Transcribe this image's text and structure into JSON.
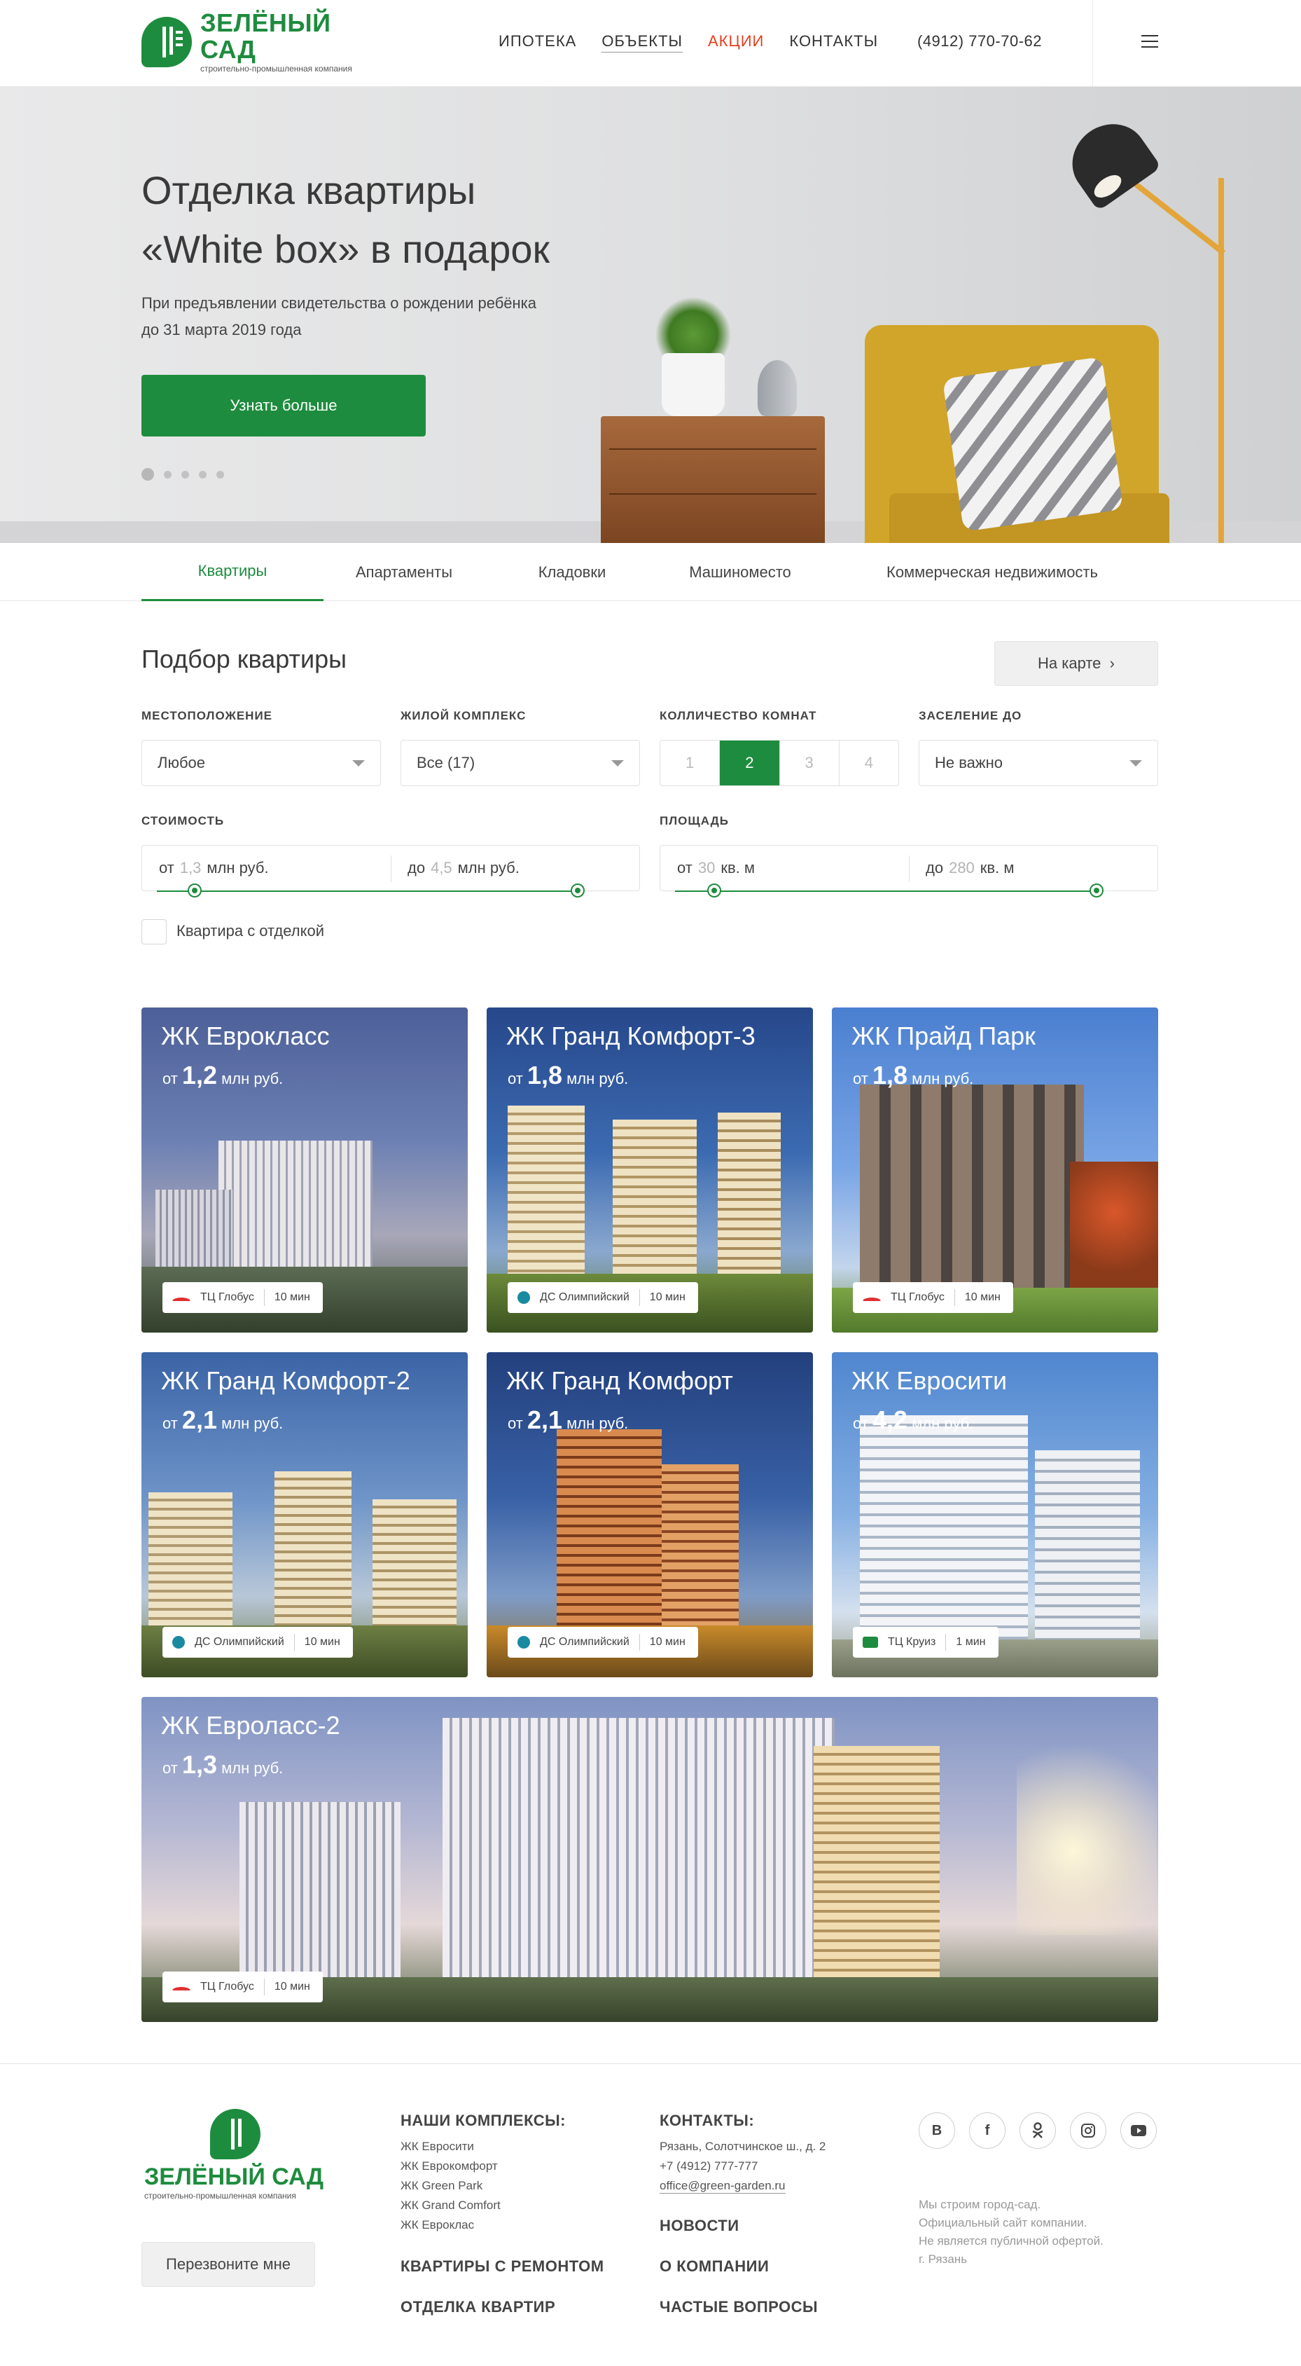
{
  "header": {
    "logo_title": "ЗЕЛЁНЫЙ САД",
    "logo_subtitle": "строительно-промышленная компания",
    "nav": [
      "ИПОТЕКА",
      "ОБЪЕКТЫ",
      "АКЦИИ",
      "КОНТАКТЫ"
    ],
    "phone": "(4912) 770-70-62",
    "menu_icon": "hamburger-icon"
  },
  "hero": {
    "title_line1": "Отделка квартиры",
    "title_line2": "«White box» в подарок",
    "subtitle_line1": "При предъявлении свидетельства о рождении ребёнка",
    "subtitle_line2": "до 31 марта 2019 года",
    "button": "Узнать больше",
    "slides_total": 5,
    "slide_active": 1
  },
  "tabs": [
    "Квартиры",
    "Апартаменты",
    "Кладовки",
    "Машиноместо",
    "Коммерческая недвижимость"
  ],
  "filter": {
    "title": "Подбор квартиры",
    "map_button": "На карте",
    "location_label": "МЕСТОПОЛОЖЕНИЕ",
    "location_value": "Любое",
    "complex_label": "ЖИЛОЙ КОМПЛЕКС",
    "complex_value": "Все (17)",
    "rooms_label": "КОЛЛИЧЕСТВО КОМНАТ",
    "rooms": [
      "1",
      "2",
      "3",
      "4"
    ],
    "rooms_selected": "2",
    "settle_label": "ЗАСЕЛЕНИЕ ДО",
    "settle_value": "Не важно",
    "price_label": "СТОИМОСТЬ",
    "price_from_prefix": "от",
    "price_from": "1,3",
    "price_unit": "млн руб.",
    "price_to_prefix": "до",
    "price_to": "4,5",
    "area_label": "ПЛОЩАДЬ",
    "area_from_prefix": "от",
    "area_from": "30",
    "area_unit": "кв. м",
    "area_to_prefix": "до",
    "area_to": "280",
    "finish_label": "Квартира с отделкой"
  },
  "cards": [
    {
      "title": "ЖК Еврокласс",
      "from": "от",
      "price": "1,2",
      "unit": "млн руб.",
      "place": "ТЦ Глобус",
      "time": "10 мин",
      "icon": "red"
    },
    {
      "title": "ЖК Гранд Комфорт-3",
      "from": "от",
      "price": "1,8",
      "unit": "млн руб.",
      "place": "ДС Олимпийский",
      "time": "10 мин",
      "icon": "teal"
    },
    {
      "title": "ЖК Прайд Парк",
      "from": "от",
      "price": "1,8",
      "unit": "млн руб.",
      "place": "ТЦ Глобус",
      "time": "10 мин",
      "icon": "red"
    },
    {
      "title": "ЖК Гранд Комфорт-2",
      "from": "от",
      "price": "2,1",
      "unit": "млн руб.",
      "place": "ДС Олимпийский",
      "time": "10 мин",
      "icon": "teal"
    },
    {
      "title": "ЖК Гранд Комфорт",
      "from": "от",
      "price": "2,1",
      "unit": "млн руб.",
      "place": "ДС Олимпийский",
      "time": "10 мин",
      "icon": "teal"
    },
    {
      "title": "ЖК Евросити",
      "from": "от",
      "price": "4,2",
      "unit": "млн руб.",
      "place": "ТЦ Круиз",
      "time": "1 мин",
      "icon": "green"
    },
    {
      "title": "ЖК Евроласс-2",
      "from": "от",
      "price": "1,3",
      "unit": "млн руб.",
      "place": "ТЦ Глобус",
      "time": "10 мин",
      "icon": "red"
    }
  ],
  "footer": {
    "logo_title": "ЗЕЛЁНЫЙ САД",
    "logo_subtitle": "строительно-промышленная компания",
    "callback": "Перезвоните мне",
    "complexes_title": "НАШИ КОМПЛЕКСЫ:",
    "complexes": [
      "ЖК Евросити",
      "ЖК Еврокомфорт",
      "ЖК Green Park",
      "ЖК Grand Comfort",
      "ЖК Евроклас"
    ],
    "repair_flats": "КВАРТИРЫ С РЕМОНТОМ",
    "finishing": "ОТДЕЛКА КВАРТИР",
    "contacts_title": "КОНТАКТЫ:",
    "address": "Рязань, Солотчинское ш., д. 2",
    "phone": "+7 (4912) 777-777",
    "email": "office@green-garden.ru",
    "news": "НОВОСТИ",
    "about": "О КОМПАНИИ",
    "faq": "ЧАСТЫЕ ВОПРОСЫ",
    "social": [
      "В",
      "f",
      "ok",
      "ig",
      "yt"
    ],
    "note": [
      "Мы строим город-сад.",
      "Официальный сайт компании.",
      "Не является публичной офертой.",
      "г. Рязань"
    ]
  }
}
